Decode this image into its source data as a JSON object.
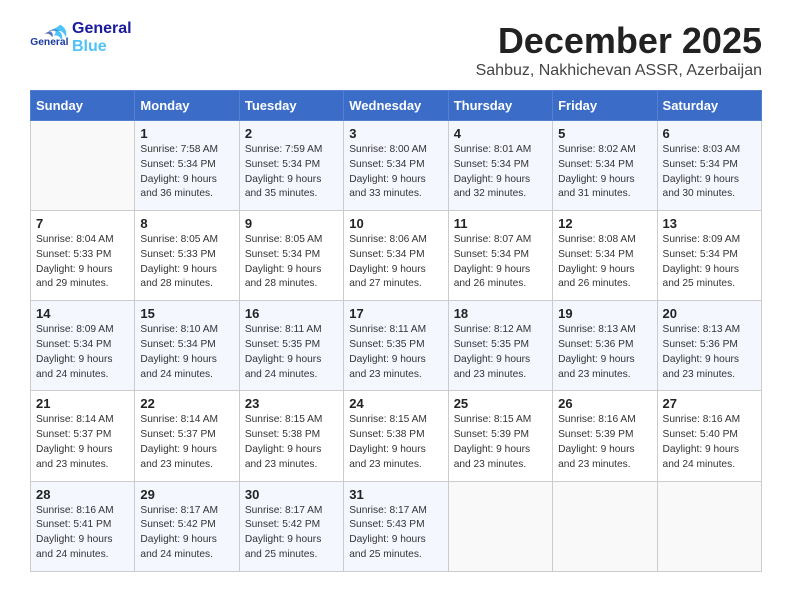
{
  "header": {
    "logo_general": "General",
    "logo_blue": "Blue",
    "month_title": "December 2025",
    "location": "Sahbuz, Nakhichevan ASSR, Azerbaijan"
  },
  "days_of_week": [
    "Sunday",
    "Monday",
    "Tuesday",
    "Wednesday",
    "Thursday",
    "Friday",
    "Saturday"
  ],
  "weeks": [
    [
      {
        "day": "",
        "info": ""
      },
      {
        "day": "1",
        "info": "Sunrise: 7:58 AM\nSunset: 5:34 PM\nDaylight: 9 hours\nand 36 minutes."
      },
      {
        "day": "2",
        "info": "Sunrise: 7:59 AM\nSunset: 5:34 PM\nDaylight: 9 hours\nand 35 minutes."
      },
      {
        "day": "3",
        "info": "Sunrise: 8:00 AM\nSunset: 5:34 PM\nDaylight: 9 hours\nand 33 minutes."
      },
      {
        "day": "4",
        "info": "Sunrise: 8:01 AM\nSunset: 5:34 PM\nDaylight: 9 hours\nand 32 minutes."
      },
      {
        "day": "5",
        "info": "Sunrise: 8:02 AM\nSunset: 5:34 PM\nDaylight: 9 hours\nand 31 minutes."
      },
      {
        "day": "6",
        "info": "Sunrise: 8:03 AM\nSunset: 5:34 PM\nDaylight: 9 hours\nand 30 minutes."
      }
    ],
    [
      {
        "day": "7",
        "info": "Sunrise: 8:04 AM\nSunset: 5:33 PM\nDaylight: 9 hours\nand 29 minutes."
      },
      {
        "day": "8",
        "info": "Sunrise: 8:05 AM\nSunset: 5:33 PM\nDaylight: 9 hours\nand 28 minutes."
      },
      {
        "day": "9",
        "info": "Sunrise: 8:05 AM\nSunset: 5:34 PM\nDaylight: 9 hours\nand 28 minutes."
      },
      {
        "day": "10",
        "info": "Sunrise: 8:06 AM\nSunset: 5:34 PM\nDaylight: 9 hours\nand 27 minutes."
      },
      {
        "day": "11",
        "info": "Sunrise: 8:07 AM\nSunset: 5:34 PM\nDaylight: 9 hours\nand 26 minutes."
      },
      {
        "day": "12",
        "info": "Sunrise: 8:08 AM\nSunset: 5:34 PM\nDaylight: 9 hours\nand 26 minutes."
      },
      {
        "day": "13",
        "info": "Sunrise: 8:09 AM\nSunset: 5:34 PM\nDaylight: 9 hours\nand 25 minutes."
      }
    ],
    [
      {
        "day": "14",
        "info": "Sunrise: 8:09 AM\nSunset: 5:34 PM\nDaylight: 9 hours\nand 24 minutes."
      },
      {
        "day": "15",
        "info": "Sunrise: 8:10 AM\nSunset: 5:34 PM\nDaylight: 9 hours\nand 24 minutes."
      },
      {
        "day": "16",
        "info": "Sunrise: 8:11 AM\nSunset: 5:35 PM\nDaylight: 9 hours\nand 24 minutes."
      },
      {
        "day": "17",
        "info": "Sunrise: 8:11 AM\nSunset: 5:35 PM\nDaylight: 9 hours\nand 23 minutes."
      },
      {
        "day": "18",
        "info": "Sunrise: 8:12 AM\nSunset: 5:35 PM\nDaylight: 9 hours\nand 23 minutes."
      },
      {
        "day": "19",
        "info": "Sunrise: 8:13 AM\nSunset: 5:36 PM\nDaylight: 9 hours\nand 23 minutes."
      },
      {
        "day": "20",
        "info": "Sunrise: 8:13 AM\nSunset: 5:36 PM\nDaylight: 9 hours\nand 23 minutes."
      }
    ],
    [
      {
        "day": "21",
        "info": "Sunrise: 8:14 AM\nSunset: 5:37 PM\nDaylight: 9 hours\nand 23 minutes."
      },
      {
        "day": "22",
        "info": "Sunrise: 8:14 AM\nSunset: 5:37 PM\nDaylight: 9 hours\nand 23 minutes."
      },
      {
        "day": "23",
        "info": "Sunrise: 8:15 AM\nSunset: 5:38 PM\nDaylight: 9 hours\nand 23 minutes."
      },
      {
        "day": "24",
        "info": "Sunrise: 8:15 AM\nSunset: 5:38 PM\nDaylight: 9 hours\nand 23 minutes."
      },
      {
        "day": "25",
        "info": "Sunrise: 8:15 AM\nSunset: 5:39 PM\nDaylight: 9 hours\nand 23 minutes."
      },
      {
        "day": "26",
        "info": "Sunrise: 8:16 AM\nSunset: 5:39 PM\nDaylight: 9 hours\nand 23 minutes."
      },
      {
        "day": "27",
        "info": "Sunrise: 8:16 AM\nSunset: 5:40 PM\nDaylight: 9 hours\nand 24 minutes."
      }
    ],
    [
      {
        "day": "28",
        "info": "Sunrise: 8:16 AM\nSunset: 5:41 PM\nDaylight: 9 hours\nand 24 minutes."
      },
      {
        "day": "29",
        "info": "Sunrise: 8:17 AM\nSunset: 5:42 PM\nDaylight: 9 hours\nand 24 minutes."
      },
      {
        "day": "30",
        "info": "Sunrise: 8:17 AM\nSunset: 5:42 PM\nDaylight: 9 hours\nand 25 minutes."
      },
      {
        "day": "31",
        "info": "Sunrise: 8:17 AM\nSunset: 5:43 PM\nDaylight: 9 hours\nand 25 minutes."
      },
      {
        "day": "",
        "info": ""
      },
      {
        "day": "",
        "info": ""
      },
      {
        "day": "",
        "info": ""
      }
    ]
  ]
}
